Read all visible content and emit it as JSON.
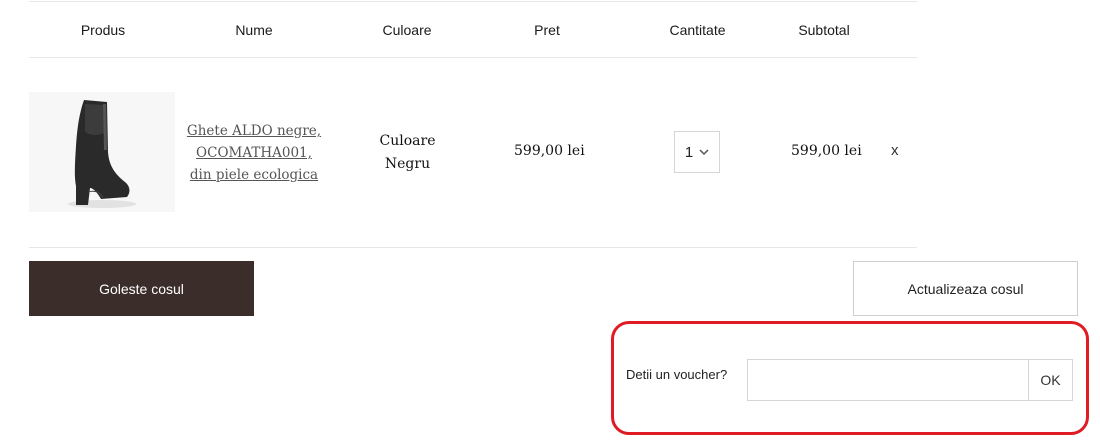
{
  "table": {
    "headers": {
      "product": "Produs",
      "name": "Nume",
      "color": "Culoare",
      "price": "Pret",
      "quantity": "Cantitate",
      "subtotal": "Subtotal"
    },
    "rows": [
      {
        "name_lines": [
          "Ghete ALDO negre,",
          "OCOMATHA001,",
          "din piele ecologica"
        ],
        "color_lines": [
          "Culoare",
          "Negru"
        ],
        "price": "599,00 lei",
        "quantity": "1",
        "subtotal": "599,00 lei",
        "remove": "x",
        "image_icon": "black-ankle-boot-icon"
      }
    ]
  },
  "actions": {
    "empty_cart": "Goleste cosul",
    "update_cart": "Actualizeaza cosul"
  },
  "voucher": {
    "label": "Detii un voucher?",
    "input_value": "",
    "ok_label": "OK"
  },
  "colors": {
    "dark_button": "#3b2d29",
    "highlight_border": "#e01b24"
  }
}
